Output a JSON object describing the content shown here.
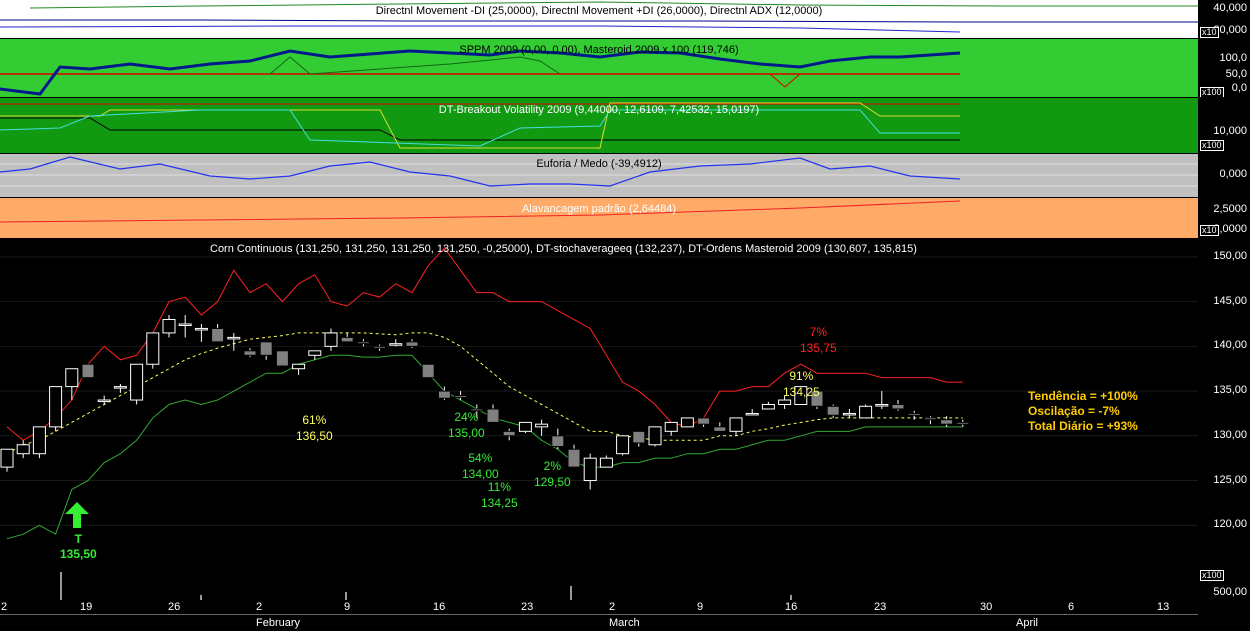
{
  "colors": {
    "dmi_bg": "#ffffff",
    "sppm_bg": "#33cc33",
    "breakout_bg": "#119911",
    "euforia_bg": "#c0c0c0",
    "alav_bg": "#ffaa66",
    "main_bg": "#000000",
    "up_candle": "#ffffff",
    "down_candle": "#808080",
    "upper_band": "#ff2222",
    "lower_band": "#33aa33",
    "mid_band": "#ffff55"
  },
  "panes": {
    "dmi": {
      "title": "Directnl Movement -DI (25,0000), Directnl Movement +DI (26,0000), Directnl ADX (12,0000)",
      "ticks": [
        "40,000",
        "20,000"
      ],
      "tag": "x10"
    },
    "sppm": {
      "title": "SPPM 2009 (0,00, 0,00), Masteroid 2009 x 100 (119,746)",
      "ticks": [
        "100,0",
        "50,0",
        "0,0"
      ],
      "tag": "x100"
    },
    "breakout": {
      "title": "DT-Breakout Volatility 2009 (9,44000, 12,6109, 7,42532, 15,0197)",
      "ticks": [
        "10,000"
      ],
      "tag": "x100"
    },
    "euforia": {
      "title": "Euforia / Medo (-39,4912)",
      "ticks": [
        "0,000"
      ]
    },
    "alav": {
      "title": "Alavancagem padrão (2,64484)",
      "ticks": [
        "2,5000",
        "2,0000"
      ],
      "tag": "x10"
    },
    "main": {
      "title": "Corn Continuous (131,250, 131,250, 131,250, 131,250, -0,25000), DT-stochaverageeq (132,237), DT-Ordens Masteroid 2009 (130,607, 135,815)",
      "ticks": [
        "150,00",
        "145,00",
        "140,00",
        "135,00",
        "130,00",
        "125,00",
        "120,00"
      ]
    },
    "volume": {
      "ticks": [
        "500,00"
      ],
      "tag": "x100"
    }
  },
  "dates": {
    "days": [
      "2",
      "19",
      "26",
      "2",
      "9",
      "16",
      "23",
      "2",
      "9",
      "16",
      "23",
      "30",
      "6",
      "13"
    ],
    "months": [
      "February",
      "March",
      "April"
    ]
  },
  "annotations": [
    {
      "pct": "61%",
      "price": "136,50",
      "color": "#ffff66"
    },
    {
      "pct": "24%",
      "price": "135,00",
      "color": "#33ee33"
    },
    {
      "pct": "54%",
      "price": "134,00",
      "color": "#33ee33"
    },
    {
      "pct": "11%",
      "price": "134,25",
      "color": "#33ee33"
    },
    {
      "pct": "2%",
      "price": "129,50",
      "color": "#33ee33"
    },
    {
      "pct": "91%",
      "price": "134,25",
      "color": "#ffff66"
    },
    {
      "pct": "7%",
      "price": "135,75",
      "color": "#ff2222"
    }
  ],
  "signal": {
    "label": "T",
    "price": "135,50"
  },
  "legend": {
    "tendencia": "Tendência = +100%",
    "oscilacao": "Oscilação = -7%",
    "total": "Total Diário = +93%"
  },
  "chart_data": {
    "type": "candlestick",
    "title": "Corn Continuous (131,250, 131,250, 131,250, 131,250, -0,25000), DT-stochaverageeq (132,237), DT-Ordens Masteroid 2009 (130,607, 135,815)",
    "ylim": [
      115,
      152
    ],
    "candles": [
      [
        126.5,
        128.5,
        126,
        128.5
      ],
      [
        128,
        129.5,
        127.5,
        129
      ],
      [
        128,
        131,
        127.5,
        131
      ],
      [
        131,
        135.5,
        130.5,
        135.5
      ],
      [
        135.5,
        137.5,
        134,
        137.5
      ],
      [
        138,
        138,
        136.5,
        136.5
      ],
      [
        134,
        134.5,
        133.5,
        134
      ],
      [
        135.5,
        135.8,
        134.8,
        135.5
      ],
      [
        134,
        138,
        133.5,
        138
      ],
      [
        138,
        141.5,
        137.5,
        141.5
      ],
      [
        141.5,
        143.5,
        141,
        143
      ],
      [
        142.5,
        143.5,
        141,
        142.5
      ],
      [
        142,
        142.5,
        140.5,
        142
      ],
      [
        142,
        142.5,
        140.5,
        140.5
      ],
      [
        141,
        141.5,
        139.5,
        141
      ],
      [
        139.5,
        139.8,
        138.8,
        139
      ],
      [
        140.5,
        140.5,
        138.5,
        139
      ],
      [
        139.5,
        139.5,
        137.8,
        137.8
      ],
      [
        137.5,
        138,
        136.8,
        138
      ],
      [
        139,
        139.5,
        138.5,
        139.5
      ],
      [
        140,
        142,
        139.5,
        141.5
      ],
      [
        141,
        141.5,
        140.5,
        140.5
      ],
      [
        140.5,
        140.8,
        140,
        140.3
      ],
      [
        140,
        140.2,
        139.5,
        139.8
      ],
      [
        140.3,
        140.8,
        140,
        140.3
      ],
      [
        140.5,
        140.8,
        139.8,
        140
      ],
      [
        138,
        138,
        136.5,
        136.5
      ],
      [
        135,
        135.5,
        134,
        134.2
      ],
      [
        134.5,
        135,
        134,
        134.3
      ],
      [
        133,
        133.5,
        132,
        132.8
      ],
      [
        133,
        133.5,
        131.5,
        131.5
      ],
      [
        130.5,
        130.8,
        129.5,
        130
      ],
      [
        130.5,
        131.5,
        130.3,
        131.5
      ],
      [
        131,
        131.8,
        130,
        131.3
      ],
      [
        130,
        130.8,
        128.5,
        128.8
      ],
      [
        128.5,
        129,
        126.5,
        126.5
      ],
      [
        125,
        128,
        124,
        127.5
      ],
      [
        126.5,
        127.8,
        126.5,
        127.5
      ],
      [
        128,
        130,
        127.8,
        130
      ],
      [
        130.5,
        130.5,
        128.8,
        129.2
      ],
      [
        129,
        131,
        128.8,
        131
      ],
      [
        130.5,
        131.5,
        130,
        131.5
      ],
      [
        131,
        132,
        131,
        132
      ],
      [
        132,
        132,
        131,
        131.3
      ],
      [
        131,
        131.5,
        130.5,
        130.5
      ],
      [
        130.5,
        132,
        130,
        132
      ],
      [
        132.5,
        133,
        132.3,
        132.5
      ],
      [
        133,
        133.8,
        133,
        133.5
      ],
      [
        133.5,
        134.5,
        133,
        134
      ],
      [
        133.5,
        135.5,
        133.5,
        135.5
      ],
      [
        135,
        135,
        133,
        133.3
      ],
      [
        133.3,
        133.5,
        132,
        132.3
      ],
      [
        132.5,
        133,
        132,
        132.5
      ],
      [
        132,
        133.5,
        132,
        133.3
      ],
      [
        133.5,
        135,
        133,
        133.5
      ],
      [
        133.5,
        134,
        132.8,
        133
      ],
      [
        132.5,
        132.8,
        131.8,
        132.3
      ],
      [
        132,
        132.2,
        131.3,
        131.8
      ],
      [
        131.8,
        132.2,
        131,
        131.3
      ],
      [
        131.5,
        131.8,
        131,
        131.3
      ]
    ],
    "upper_band": [
      131,
      129.5,
      130.5,
      132,
      134,
      138,
      140,
      138.5,
      139,
      141.5,
      145,
      145.5,
      143.5,
      145,
      148.5,
      146,
      147,
      145,
      147,
      148,
      145,
      144.5,
      146,
      145.5,
      147,
      146,
      149,
      151,
      148.5,
      146,
      146,
      145,
      145,
      145,
      144,
      143,
      142,
      139,
      136,
      135,
      133.5,
      131.5,
      131,
      132,
      135,
      135,
      135.5,
      135.5,
      137,
      138,
      137,
      137,
      137,
      137,
      136.5,
      136.5,
      136.5,
      136.5,
      136,
      136
    ],
    "lower_band": [
      118.5,
      119,
      120,
      119,
      124,
      125,
      127,
      128,
      129.5,
      132,
      133.5,
      134,
      133.5,
      134,
      135,
      136,
      137,
      137,
      138,
      138.5,
      139,
      139,
      138.8,
      138.8,
      139,
      139,
      137,
      135,
      134,
      133,
      132,
      131.5,
      131,
      129.5,
      128.5,
      127,
      126.5,
      126.5,
      127,
      127,
      127.5,
      127.5,
      128,
      128,
      128.5,
      128.5,
      129,
      129.5,
      129.5,
      130,
      130.5,
      130.5,
      130.5,
      131,
      131,
      131,
      131,
      131,
      131,
      131
    ],
    "mid_band": [
      128,
      129,
      129.5,
      130.5,
      131.5,
      132.5,
      133.5,
      134.5,
      135.5,
      136.5,
      137.5,
      138.5,
      139.2,
      139.8,
      140.3,
      140.8,
      141,
      141.2,
      141.5,
      141.5,
      141.5,
      141.5,
      141.5,
      141.4,
      141.3,
      141.5,
      141.5,
      141,
      140,
      138.5,
      137,
      135.5,
      134.5,
      133.5,
      132.5,
      131.5,
      130.5,
      130.5,
      130,
      129.8,
      129.5,
      129.5,
      129.5,
      129.5,
      130,
      130,
      130.5,
      130.8,
      131.2,
      131.5,
      131.8,
      132,
      132,
      132,
      132,
      132,
      132,
      132,
      132,
      132
    ]
  }
}
